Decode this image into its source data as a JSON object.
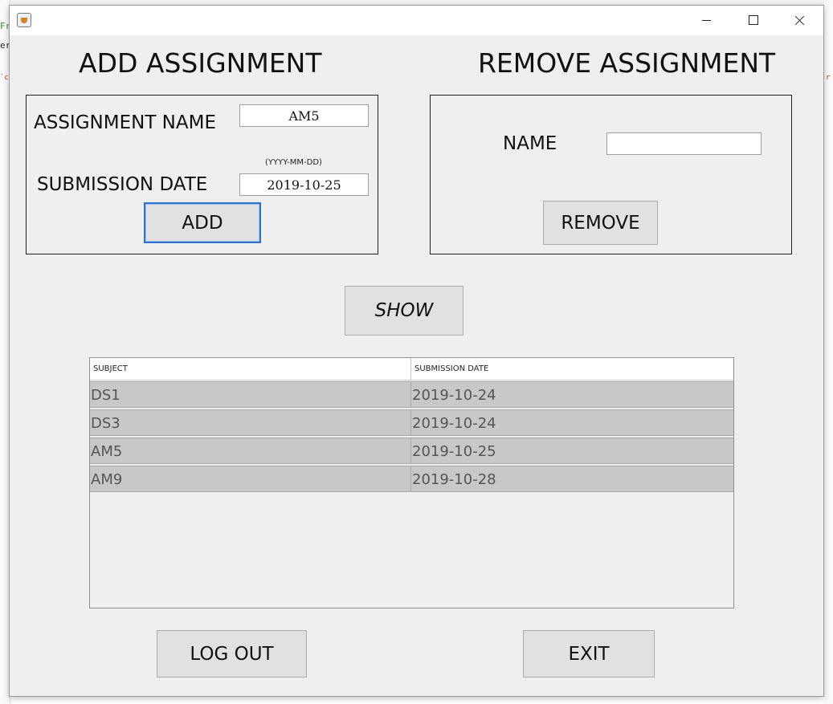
{
  "background": {
    "left_fragments": [
      "Fr",
      "er",
      "`c"
    ],
    "right_fragment": "r"
  },
  "window": {
    "title": "",
    "controls": {
      "minimize": "minimize-icon",
      "maximize": "maximize-icon",
      "close": "close-icon"
    }
  },
  "add_section": {
    "heading": "ADD ASSIGNMENT",
    "name_label": "ASSIGNMENT NAME",
    "name_value": "AM5",
    "date_hint": "(YYYY-MM-DD)",
    "date_label": "SUBMISSION DATE",
    "date_value": "2019-10-25",
    "add_button": "ADD"
  },
  "remove_section": {
    "heading": "REMOVE ASSIGNMENT",
    "name_label": "NAME",
    "name_value": "",
    "remove_button": "REMOVE"
  },
  "show_button": "SHOW",
  "table": {
    "columns": [
      "SUBJECT",
      "SUBMISSION DATE"
    ],
    "rows": [
      [
        "DS1",
        "2019-10-24"
      ],
      [
        "DS3",
        "2019-10-24"
      ],
      [
        "AM5",
        "2019-10-25"
      ],
      [
        "AM9",
        "2019-10-28"
      ]
    ]
  },
  "footer": {
    "logout_button": "LOG OUT",
    "exit_button": "EXIT"
  },
  "colors": {
    "window_bg": "#efefef",
    "button_bg": "#e1e1e1",
    "row_bg": "#c8c8c8",
    "focus_border": "#2f71d1"
  }
}
